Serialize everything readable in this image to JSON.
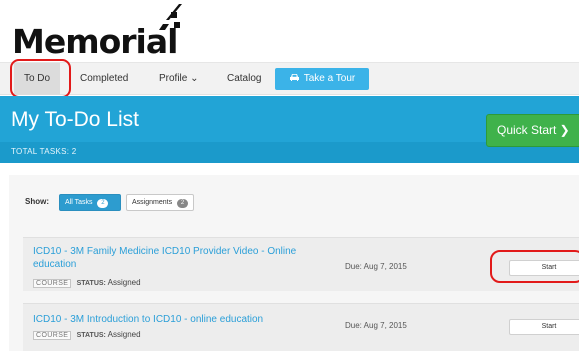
{
  "logo": {
    "text": "Memorial"
  },
  "nav": {
    "items": [
      {
        "label": "To Do"
      },
      {
        "label": "Completed"
      },
      {
        "label": "Profile ⌄"
      },
      {
        "label": "Catalog"
      }
    ],
    "tour_button": {
      "label": "Take a Tour",
      "icon": "car-icon"
    }
  },
  "header": {
    "title": "My To-Do List",
    "total_tasks": "TOTAL TASKS: 2",
    "quick_start": "Quick Start ❯"
  },
  "filters": {
    "show_label": "Show:",
    "all_tasks": {
      "label": "All Tasks",
      "count": "2"
    },
    "assignments": {
      "label": "Assignments",
      "count": "2"
    }
  },
  "tasks": [
    {
      "title": "ICD10 - 3M Family Medicine ICD10 Provider Video - Online education",
      "type": "COURSE",
      "status_label": "STATUS:",
      "status": "Assigned",
      "due": "Due: Aug 7, 2015",
      "action": "Start"
    },
    {
      "title": "ICD10 - 3M Introduction to ICD10 - online education",
      "type": "COURSE",
      "status_label": "STATUS:",
      "status": "Assigned",
      "due": "Due: Aug 7, 2015",
      "action": "Start"
    }
  ],
  "colors": {
    "accent_blue": "#22a4d6",
    "quick_start_green": "#3fb24b",
    "annotation_red": "#e21a1a",
    "link_blue": "#2b9fd8"
  }
}
